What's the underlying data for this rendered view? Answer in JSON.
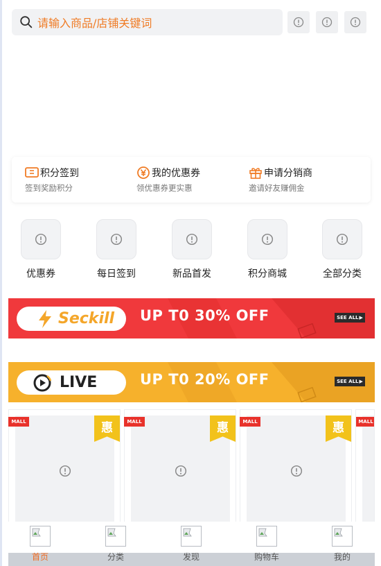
{
  "search": {
    "placeholder": "请输入商品/店铺关键词"
  },
  "header_icons": [
    "info-icon",
    "info-icon",
    "info-icon"
  ],
  "quick_links": [
    {
      "title": "积分签到",
      "subtitle": "签到奖励积分",
      "icon": "ticket-icon"
    },
    {
      "title": "我的优惠券",
      "subtitle": "领优惠券更实惠",
      "icon": "yen-coin-icon"
    },
    {
      "title": "申请分销商",
      "subtitle": "邀请好友赚佣金",
      "icon": "gift-icon"
    }
  ],
  "categories": [
    {
      "label": "优惠券"
    },
    {
      "label": "每日签到"
    },
    {
      "label": "新品首发"
    },
    {
      "label": "积分商城"
    },
    {
      "label": "全部分类"
    }
  ],
  "banners": [
    {
      "pill_text": "Seckill",
      "headline": "UP T0 30% OFF",
      "see_all": "SEE ALL",
      "color": "#f0393c",
      "accent": "#f4a62a",
      "icon": "lightning-icon"
    },
    {
      "pill_text": "LIVE",
      "headline": "UP T0 20% OFF",
      "see_all": "SEE ALL",
      "color": "#f6b12c",
      "accent": "#222222",
      "icon": "live-play-icon"
    }
  ],
  "products": [
    {
      "mall_tag": "MALL",
      "badge": "惠"
    },
    {
      "mall_tag": "MALL",
      "badge": "惠"
    },
    {
      "mall_tag": "MALL",
      "badge": "惠"
    },
    {
      "mall_tag": "MALL",
      "badge": ""
    }
  ],
  "tabbar": [
    {
      "label": "首页",
      "active": true
    },
    {
      "label": "分类"
    },
    {
      "label": "发现"
    },
    {
      "label": "购物车"
    },
    {
      "label": "我的"
    }
  ],
  "colors": {
    "accent": "#f06b22",
    "seckill_red": "#f0393c",
    "live_yellow": "#f6b12c",
    "mall_red": "#e8322b",
    "badge_yellow": "#f2c21b"
  }
}
